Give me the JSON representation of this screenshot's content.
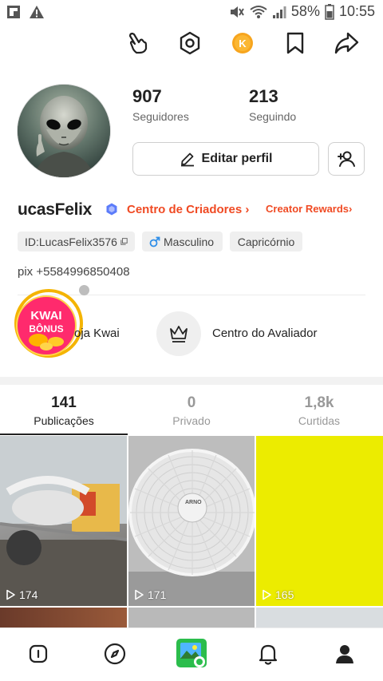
{
  "status_bar": {
    "battery": "58%",
    "time": "10:55"
  },
  "top_icons": [
    "gesture-icon",
    "settings-hex-icon",
    "kwai-coin-icon",
    "bookmark-icon",
    "share-icon"
  ],
  "profile": {
    "followers_count": "907",
    "followers_label": "Seguidores",
    "following_count": "213",
    "following_label": "Seguindo",
    "edit_button": "Editar perfil",
    "username": "ucasFelix",
    "creators_link": "Centro de Criadores",
    "rewards_link": "Creator Rewards",
    "tags": {
      "id": "ID:LucasFelix3576",
      "gender": "Masculino",
      "sign": "Capricórnio"
    },
    "bio": "pix +5584996850408"
  },
  "shortcuts": {
    "kwai_badge_line1": "KWAI",
    "kwai_badge_line2": "BÔNUS",
    "loja_label": "oja Kwai",
    "avaliador_label": "Centro do Avaliador"
  },
  "tabs": [
    {
      "count": "141",
      "label": "Publicações",
      "active": true
    },
    {
      "count": "0",
      "label": "Privado",
      "active": false
    },
    {
      "count": "1,8k",
      "label": "Curtidas",
      "active": false
    }
  ],
  "videos": [
    {
      "views": "174"
    },
    {
      "views": "171",
      "caption": "ARNO"
    },
    {
      "views": "165"
    }
  ],
  "colors": {
    "accent": "#f04a23",
    "verified": "#5c7cfa",
    "gender": "#2f8ee8",
    "yellow_tile": "#ecec00"
  },
  "bottom_nav": [
    "info-icon",
    "discover-compass-icon",
    "create-camera-icon",
    "notifications-bell-icon",
    "profile-icon"
  ]
}
